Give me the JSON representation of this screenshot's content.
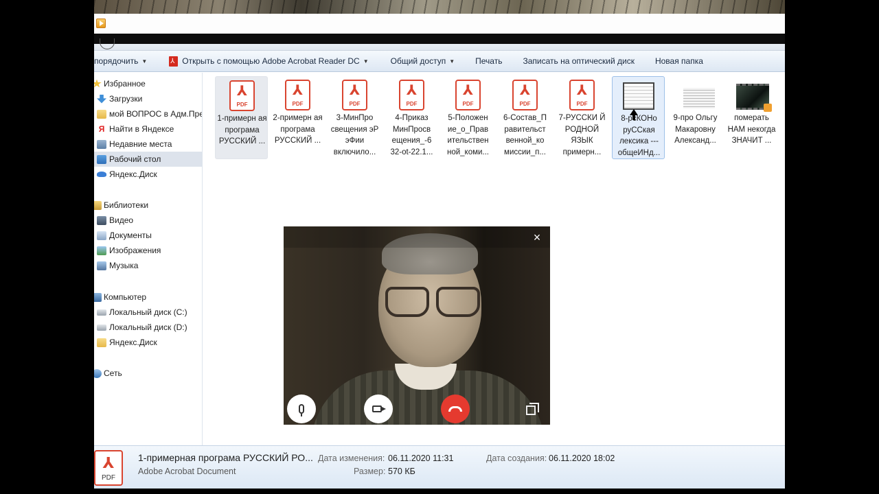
{
  "toolbar": {
    "organize": "порядочить",
    "open_with": "Открыть с помощью Adobe Acrobat Reader DC",
    "share": "Общий доступ",
    "print": "Печать",
    "burn": "Записать на оптический диск",
    "new_folder": "Новая папка"
  },
  "nav": {
    "favorites": "Избранное",
    "downloads": "Загрузки",
    "my_question": "мой ВОПРОС в Адм.Пре",
    "find_yandex": "Найти в Яндексе",
    "recent": "Недавние места",
    "desktop": "Рабочий стол",
    "yandex_disk": "Яндекс.Диск",
    "libraries": "Библиотеки",
    "video": "Видео",
    "documents": "Документы",
    "images": "Изображения",
    "music": "Музыка",
    "computer": "Компьютер",
    "local_c": "Локальный диск (C:)",
    "local_d": "Локальный диск (D:)",
    "yandex_disk_2": "Яндекс.Диск",
    "network": "Сеть"
  },
  "files": [
    {
      "name": "1-примерн ая програма РУССКИЙ ...",
      "type": "pdf",
      "label": "PDF"
    },
    {
      "name": "2-примерн ая програма РУССКИЙ ...",
      "type": "pdf",
      "label": "PDF"
    },
    {
      "name": "3-МинПро свещения эР эФии включило...",
      "type": "pdf",
      "label": "PDF"
    },
    {
      "name": "4-Приказ МинПросв ещения_-6 32-ot-22.1...",
      "type": "pdf",
      "label": "PDF"
    },
    {
      "name": "5-Положен ие_о_Прав ительствен ной_коми...",
      "type": "pdf",
      "label": "PDF"
    },
    {
      "name": "6-Состав_П равительст венной_ко миссии_п...",
      "type": "pdf",
      "label": "PDF"
    },
    {
      "name": "7-РУССКИ Й РОДНОЙ ЯЗЫК примерн...",
      "type": "pdf",
      "label": "PDF"
    },
    {
      "name": "8-рсКОНо руССкая лексика --- общеИНд...",
      "type": "doc"
    },
    {
      "name": "9-про Ольгу Макаровну Александ...",
      "type": "doc"
    },
    {
      "name": "померать НАМ некогда ЗНАЧИТ ...",
      "type": "video"
    }
  ],
  "details": {
    "name": "1-примерная програма РУССКИЙ РО...",
    "type": "Adobe Acrobat Document",
    "modified_label": "Дата изменения:",
    "modified_value": "06.11.2020 11:31",
    "created_label": "Дата создания:",
    "created_value": "06.11.2020 18:02",
    "size_label": "Размер:",
    "size_value": "570 КБ",
    "icon_label": "PDF"
  },
  "call": {
    "close": "×"
  },
  "colors": {
    "pdf_red": "#d9442f",
    "end_call_red": "#e53a2f",
    "selection_blue": "#e4eefb"
  }
}
